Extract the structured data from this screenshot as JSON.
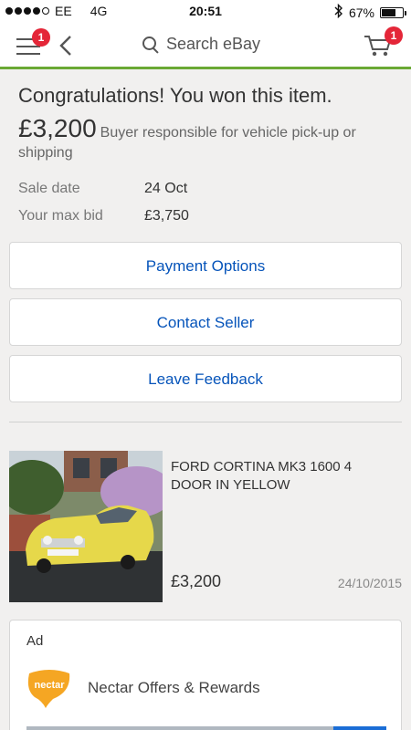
{
  "status_bar": {
    "carrier": "EE",
    "network": "4G",
    "time": "20:51",
    "battery": "67%",
    "battery_level": 0.67,
    "signal_bars": 4,
    "signal_total": 5
  },
  "nav": {
    "menu_badge": "1",
    "search_placeholder": "Search eBay",
    "cart_badge": "1",
    "accent_color": "#6aa934"
  },
  "result": {
    "headline": "Congratulations! You won this item.",
    "price": "£3,200",
    "price_note": "Buyer responsible for vehicle pick-up or shipping",
    "details": [
      {
        "label": "Sale date",
        "value": "24 Oct"
      },
      {
        "label": "Your max bid",
        "value": "£3,750"
      }
    ]
  },
  "actions": [
    {
      "label": "Payment Options"
    },
    {
      "label": "Contact Seller"
    },
    {
      "label": "Leave Feedback"
    }
  ],
  "item": {
    "title": "FORD CORTINA MK3 1600 4 DOOR IN YELLOW",
    "price": "£3,200",
    "date": "24/10/2015",
    "plate": "TCT 741L"
  },
  "ad": {
    "label": "Ad",
    "logo_text": "nectar",
    "text": "Nectar Offers & Rewards"
  },
  "colors": {
    "link_blue": "#0654ba",
    "badge_red": "#e42638",
    "nectar_orange": "#f5a623"
  }
}
